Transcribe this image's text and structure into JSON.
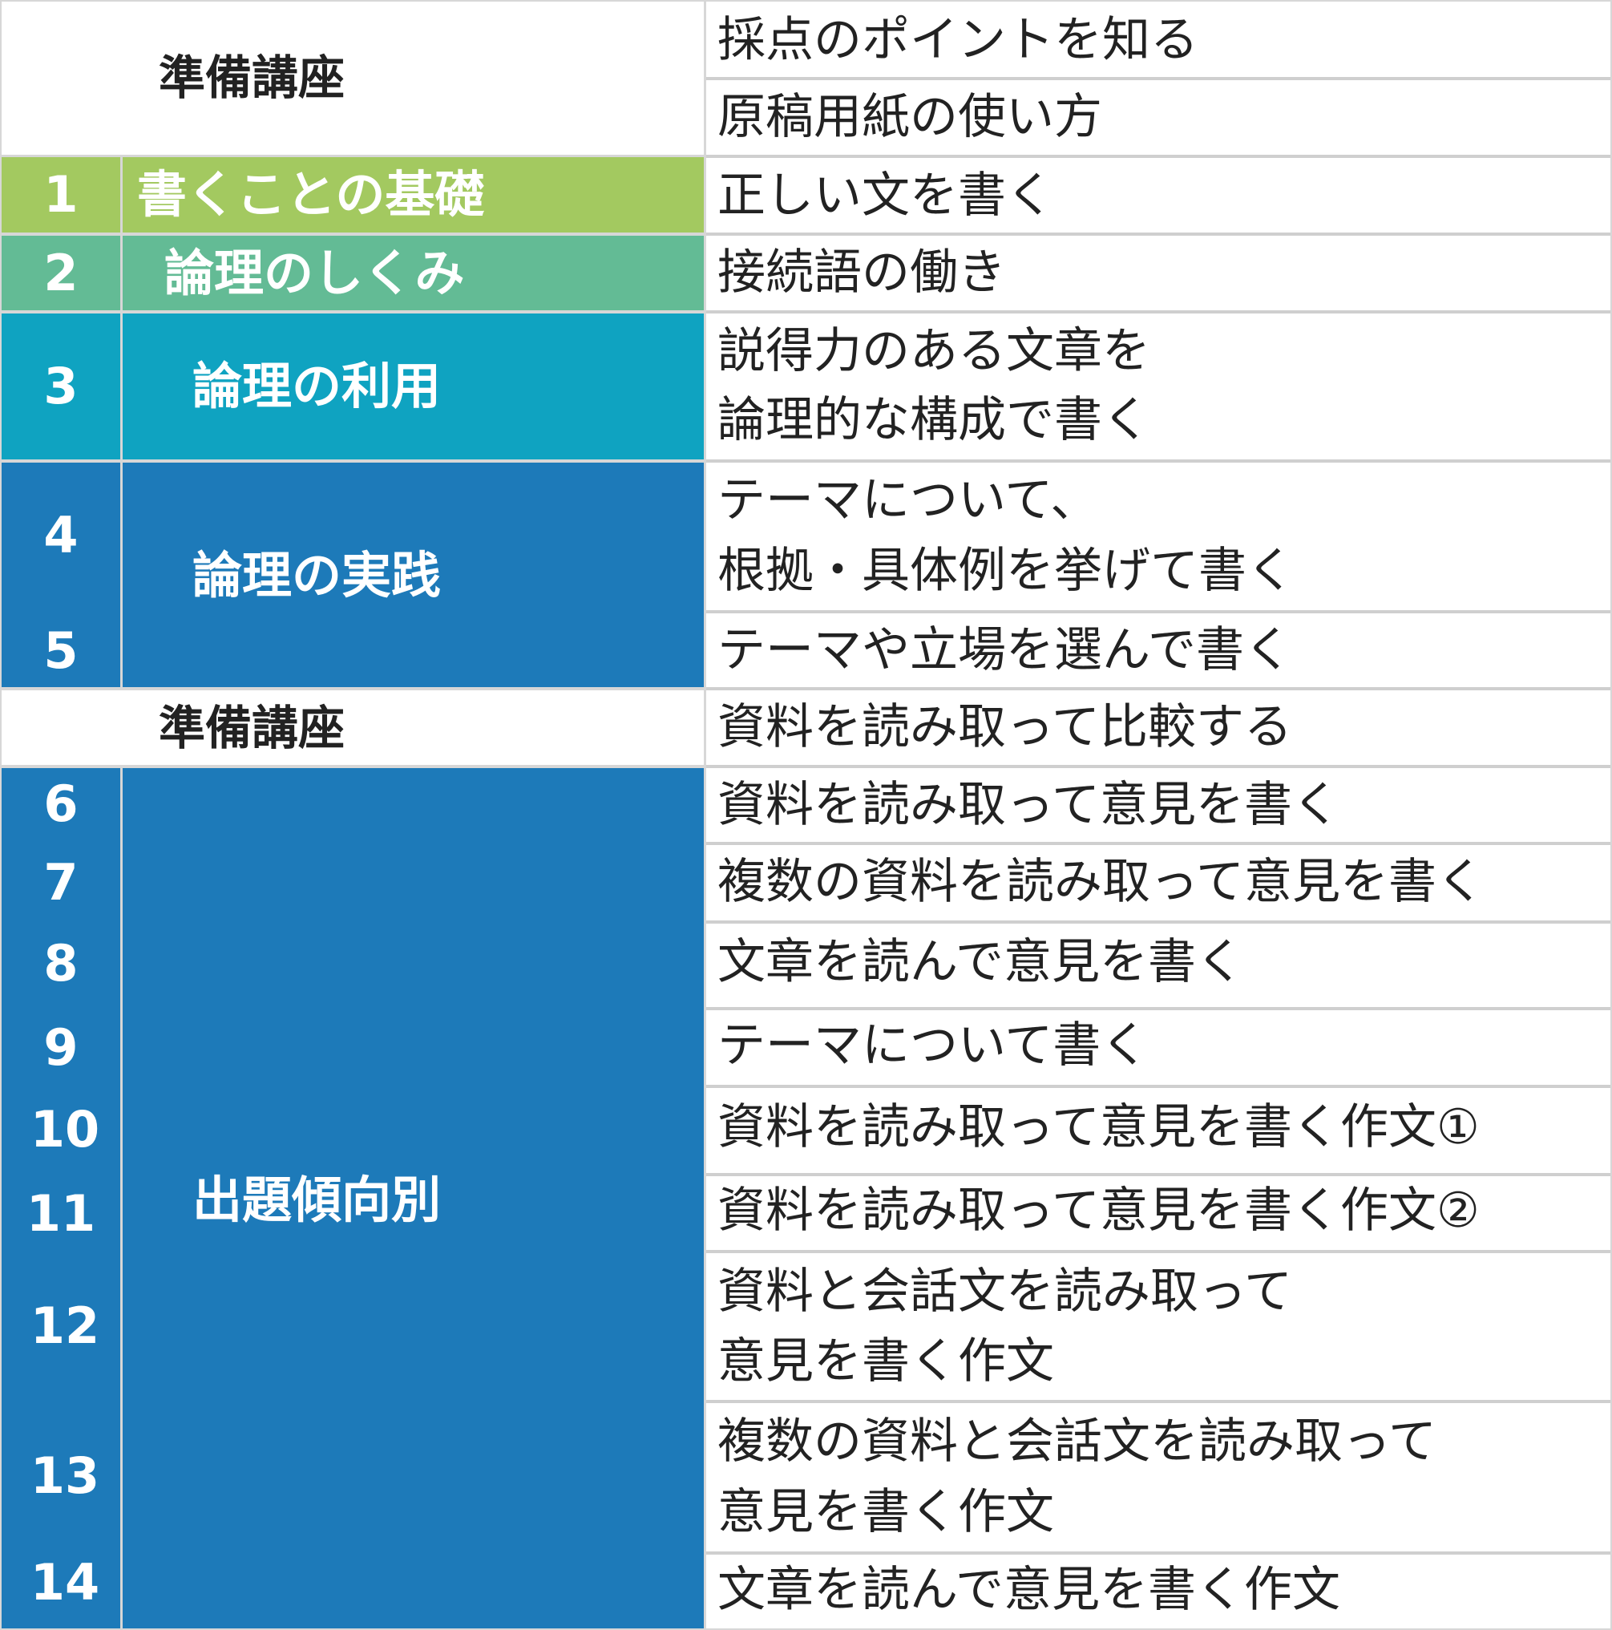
{
  "headers": {
    "prep_1": "準備講座",
    "prep_2": "準備講座"
  },
  "units": {
    "u1": {
      "number": "1",
      "title": "書くことの基礎"
    },
    "u2": {
      "number": "2",
      "title": "論理のしくみ"
    },
    "u3": {
      "number": "3",
      "title": "論理の利用"
    },
    "u4": {
      "numbers": [
        "4",
        "5"
      ],
      "title": "論理の実践"
    },
    "u5": {
      "numbers": [
        "6",
        "7",
        "8",
        "9",
        "10",
        "11",
        "12",
        "13",
        "14"
      ],
      "title": "出題傾向別"
    }
  },
  "topics": [
    "採点のポイントを知る",
    "原稿用紙の使い方",
    "正しい文を書く",
    "接続語の働き",
    "説得力のある文章を",
    "論理的な構成で書く",
    "テーマについて、",
    "根拠・具体例を挙げて書く",
    "テーマや立場を選んで書く",
    "資料を読み取って比較する",
    "資料を読み取って意見を書く",
    "複数の資料を読み取って意見を書く",
    "文章を読んで意見を書く",
    "テーマについて書く",
    "資料を読み取って意見を書く作文①",
    "資料を読み取って意見を書く作文②",
    "資料と会話文を読み取って",
    "意見を書く作文",
    "複数の資料と会話文を読み取って",
    "意見を書く作文",
    "文章を読んで意見を書く作文"
  ],
  "colors": {
    "unit1": "#a3c960",
    "unit2": "#63bb95",
    "unit3": "#0fa3c1",
    "unit4": "#1d7ab9",
    "unit5": "#1d7ab9"
  }
}
